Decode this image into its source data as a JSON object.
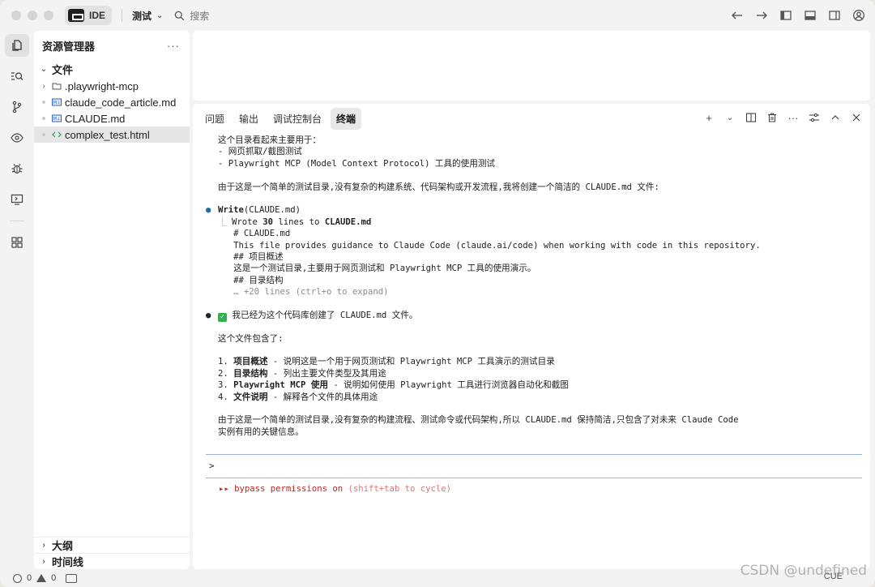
{
  "titlebar": {
    "ide_label": "IDE",
    "project": "测试",
    "search_placeholder": "搜索"
  },
  "sidebar": {
    "title": "资源管理器",
    "more": "···",
    "root": "文件",
    "items": [
      {
        "label": ".playwright-mcp",
        "kind": "folder"
      },
      {
        "label": "claude_code_article.md",
        "kind": "markdown"
      },
      {
        "label": "CLAUDE.md",
        "kind": "markdown"
      },
      {
        "label": "complex_test.html",
        "kind": "html"
      }
    ],
    "sections": [
      "大纲",
      "时间线"
    ]
  },
  "panel": {
    "tabs": [
      "问题",
      "输出",
      "调试控制台",
      "终端"
    ],
    "active_tab": "终端"
  },
  "terminal": {
    "l1": "这个目录看起来主要用于：",
    "l2": "- 网页抓取/截图测试",
    "l3": "- Playwright MCP (Model Context Protocol) 工具的使用测试",
    "l4": "由于这是一个简单的测试目录,没有复杂的构建系统、代码架构或开发流程,我将创建一个简洁的 CLAUDE.md 文件:",
    "write_tool": "Write",
    "write_arg": "(CLAUDE.md)",
    "wrote_prefix": "Wrote ",
    "wrote_count": "30",
    "wrote_mid": " lines to ",
    "wrote_file": "CLAUDE.md",
    "c1": "# CLAUDE.md",
    "c2": "This file provides guidance to Claude Code (claude.ai/code) when working with code in this repository.",
    "c3": "## 项目概述",
    "c4": "这是一个测试目录,主要用于网页测试和 Playwright MCP 工具的使用演示。",
    "c5": "## 目录结构",
    "c6": "… +20 lines (ctrl+o to expand)",
    "done": "我已经为这个代码库创建了 CLAUDE.md 文件。",
    "contains": "这个文件包含了:",
    "list": [
      {
        "num": "1. ",
        "title": "项目概述",
        "desc": " - 说明这是一个用于网页测试和 Playwright MCP 工具演示的测试目录"
      },
      {
        "num": "2. ",
        "title": "目录结构",
        "desc": " - 列出主要文件类型及其用途"
      },
      {
        "num": "3. ",
        "title": "Playwright MCP 使用",
        "desc": " - 说明如何使用 Playwright 工具进行浏览器自动化和截图"
      },
      {
        "num": "4. ",
        "title": "文件说明",
        "desc": " - 解释各个文件的具体用途"
      }
    ],
    "summary1": "由于这是一个简单的测试目录,没有复杂的构建流程、测试命令或代码架构,所以 CLAUDE.md 保持简洁,只包含了对未来 Claude Code",
    "summary2": "实例有用的关键信息。",
    "prompt": ">",
    "bypass_arrows": "▸▸ ",
    "bypass_text": "bypass permissions on",
    "bypass_hint": " (shift+tab to cycle)"
  },
  "statusbar": {
    "errors": "0",
    "warnings": "0",
    "right": "CUE"
  },
  "watermark": "CSDN @undefined"
}
